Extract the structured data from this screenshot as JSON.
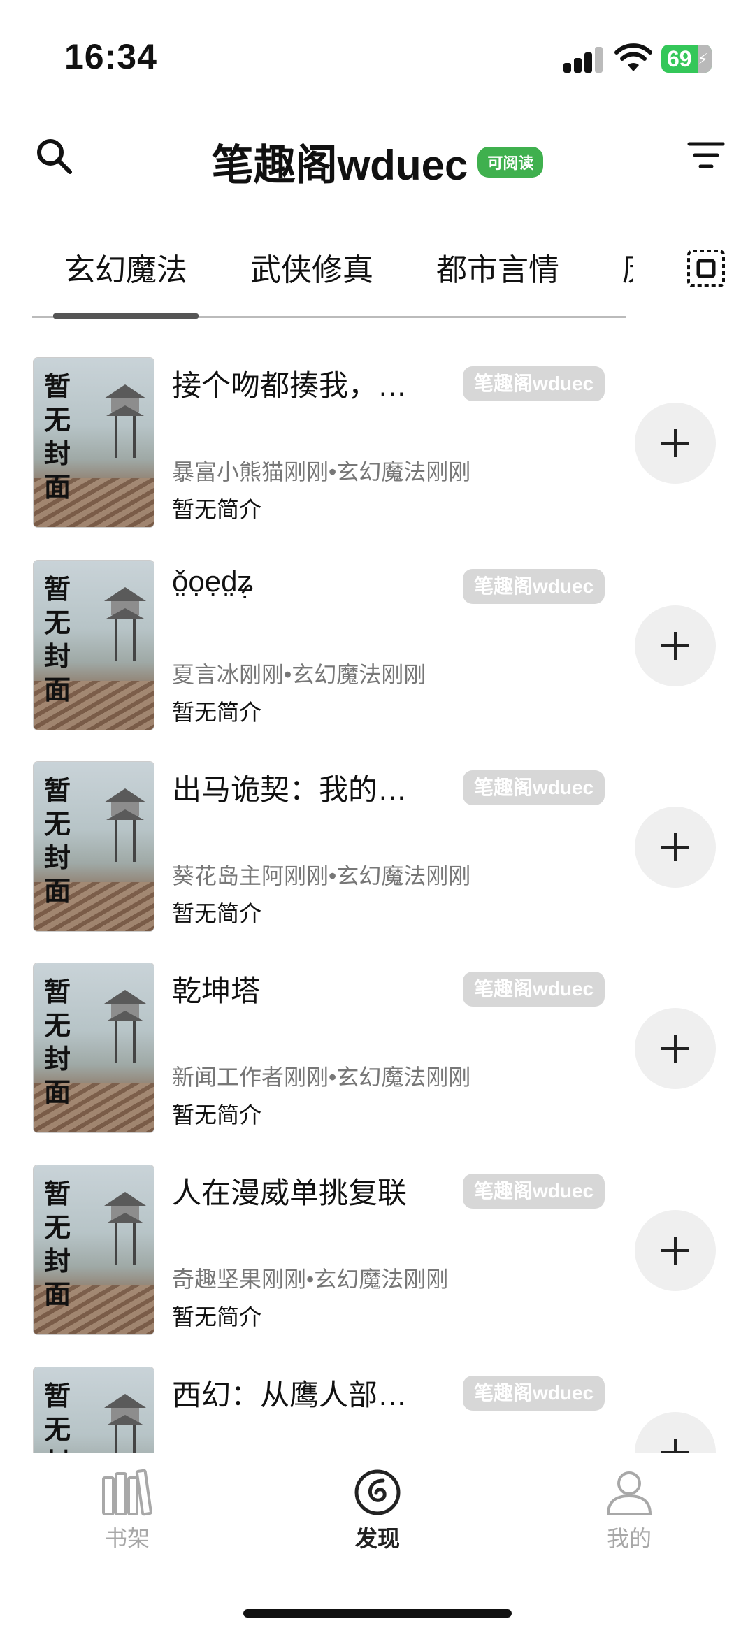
{
  "status_bar": {
    "time": "16:34",
    "battery": "69"
  },
  "header": {
    "title": "笔趣阁wduec",
    "badge": "可阅读"
  },
  "tabs": [
    {
      "label": "玄幻魔法"
    },
    {
      "label": "武侠修真"
    },
    {
      "label": "都市言情"
    },
    {
      "label": "历"
    }
  ],
  "books": [
    {
      "title": "接个吻都揍我，…",
      "source": "笔趣阁wduec",
      "meta": "暴富小熊猫刚刚•玄幻魔法刚刚",
      "intro": "暂无简介",
      "cover_text": "暂无封面"
    },
    {
      "title": "ǒ̤ọ̣ẹd̤ʑ̣",
      "source": "笔趣阁wduec",
      "meta": "夏言冰刚刚•玄幻魔法刚刚",
      "intro": "暂无简介",
      "cover_text": "暂无封面"
    },
    {
      "title": "出马诡契：我的…",
      "source": "笔趣阁wduec",
      "meta": "葵花岛主阿刚刚•玄幻魔法刚刚",
      "intro": "暂无简介",
      "cover_text": "暂无封面"
    },
    {
      "title": "乾坤塔",
      "source": "笔趣阁wduec",
      "meta": "新闻工作者刚刚•玄幻魔法刚刚",
      "intro": "暂无简介",
      "cover_text": "暂无封面"
    },
    {
      "title": "人在漫威单挑复联",
      "source": "笔趣阁wduec",
      "meta": "奇趣坚果刚刚•玄幻魔法刚刚",
      "intro": "暂无简介",
      "cover_text": "暂无封面"
    },
    {
      "title": "西幻：从鹰人部…",
      "source": "笔趣阁wduec",
      "meta": "",
      "intro": "",
      "cover_text": "暂无封面"
    }
  ],
  "bottom_nav": [
    {
      "label": "书架",
      "icon": "bookshelf-icon"
    },
    {
      "label": "发现",
      "icon": "discover-icon"
    },
    {
      "label": "我的",
      "icon": "profile-icon"
    }
  ],
  "colors": {
    "accent_green": "#3fb04e",
    "tag_gray": "#d7d7d7",
    "active_nav": "#222222",
    "inactive_nav": "#a8a8a8"
  }
}
